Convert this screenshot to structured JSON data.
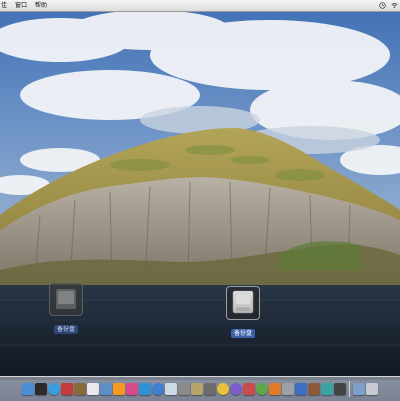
{
  "menubar": {
    "items": [
      {
        "label": "佳"
      },
      {
        "label": "窗口"
      },
      {
        "label": "帮助"
      }
    ],
    "status_icons": [
      "clock-icon",
      "wifi-icon"
    ]
  },
  "desktop": {
    "wallpaper": "mountain-island-sea",
    "icons": [
      {
        "label": "备份盘",
        "icon": "hard-drive-icon",
        "state": "dimmed"
      },
      {
        "label": "备份盘",
        "icon": "hard-drive-icon",
        "state": "selected"
      }
    ]
  },
  "dock": {
    "items": [
      {
        "name": "finder",
        "color": "#4a8fd8"
      },
      {
        "name": "dashboard",
        "color": "#2b2b2b"
      },
      {
        "name": "safari",
        "color": "#3a9de0"
      },
      {
        "name": "mail",
        "color": "#c43b3b"
      },
      {
        "name": "address-book",
        "color": "#8a6a3a"
      },
      {
        "name": "ical",
        "color": "#e9e9e9"
      },
      {
        "name": "preview",
        "color": "#5e8ec6"
      },
      {
        "name": "illustrator",
        "color": "#f39a1f"
      },
      {
        "name": "indesign",
        "color": "#d94a8c"
      },
      {
        "name": "photoshop",
        "color": "#2f8fd6"
      },
      {
        "name": "itunes",
        "color": "#3f7fd2"
      },
      {
        "name": "iphoto",
        "color": "#cdd9e5"
      },
      {
        "name": "system-preferences",
        "color": "#8a8a8a"
      },
      {
        "name": "folder",
        "color": "#b6a26a"
      },
      {
        "name": "utility",
        "color": "#6b6b6b"
      },
      {
        "name": "app-yellow",
        "color": "#e8c23a"
      },
      {
        "name": "app-purple",
        "color": "#7b5fc7"
      },
      {
        "name": "app-red",
        "color": "#c94b4b"
      },
      {
        "name": "app-green",
        "color": "#5ea84a"
      },
      {
        "name": "app-orange",
        "color": "#e07a2a"
      },
      {
        "name": "app-gray",
        "color": "#9aa2aa"
      },
      {
        "name": "app-blue",
        "color": "#3c6fc0"
      },
      {
        "name": "app-brown",
        "color": "#8c5a3a"
      },
      {
        "name": "app-teal",
        "color": "#3aa3a3"
      },
      {
        "name": "app-dark",
        "color": "#444444"
      }
    ],
    "after_divider": [
      {
        "name": "downloads",
        "color": "#7da0c8"
      },
      {
        "name": "trash",
        "color": "#c8ccd2"
      }
    ]
  }
}
